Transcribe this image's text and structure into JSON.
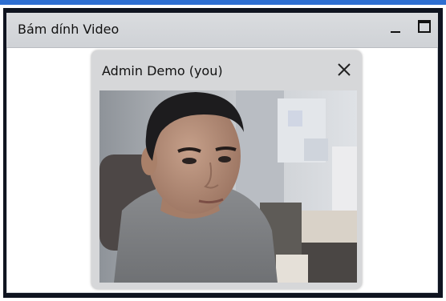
{
  "window": {
    "title": "Bám dính Video",
    "minimize_icon": "minimize-icon",
    "maximize_icon": "maximize-icon"
  },
  "video_panel": {
    "participant_label": "Admin Demo (you)",
    "close_icon": "close-icon",
    "feed": "webcam-video"
  },
  "colors": {
    "top_strip": "#2e6fd1",
    "frame": "#0f1420",
    "titlebar": "#d2d4d8",
    "panel": "#d6d7d9"
  }
}
